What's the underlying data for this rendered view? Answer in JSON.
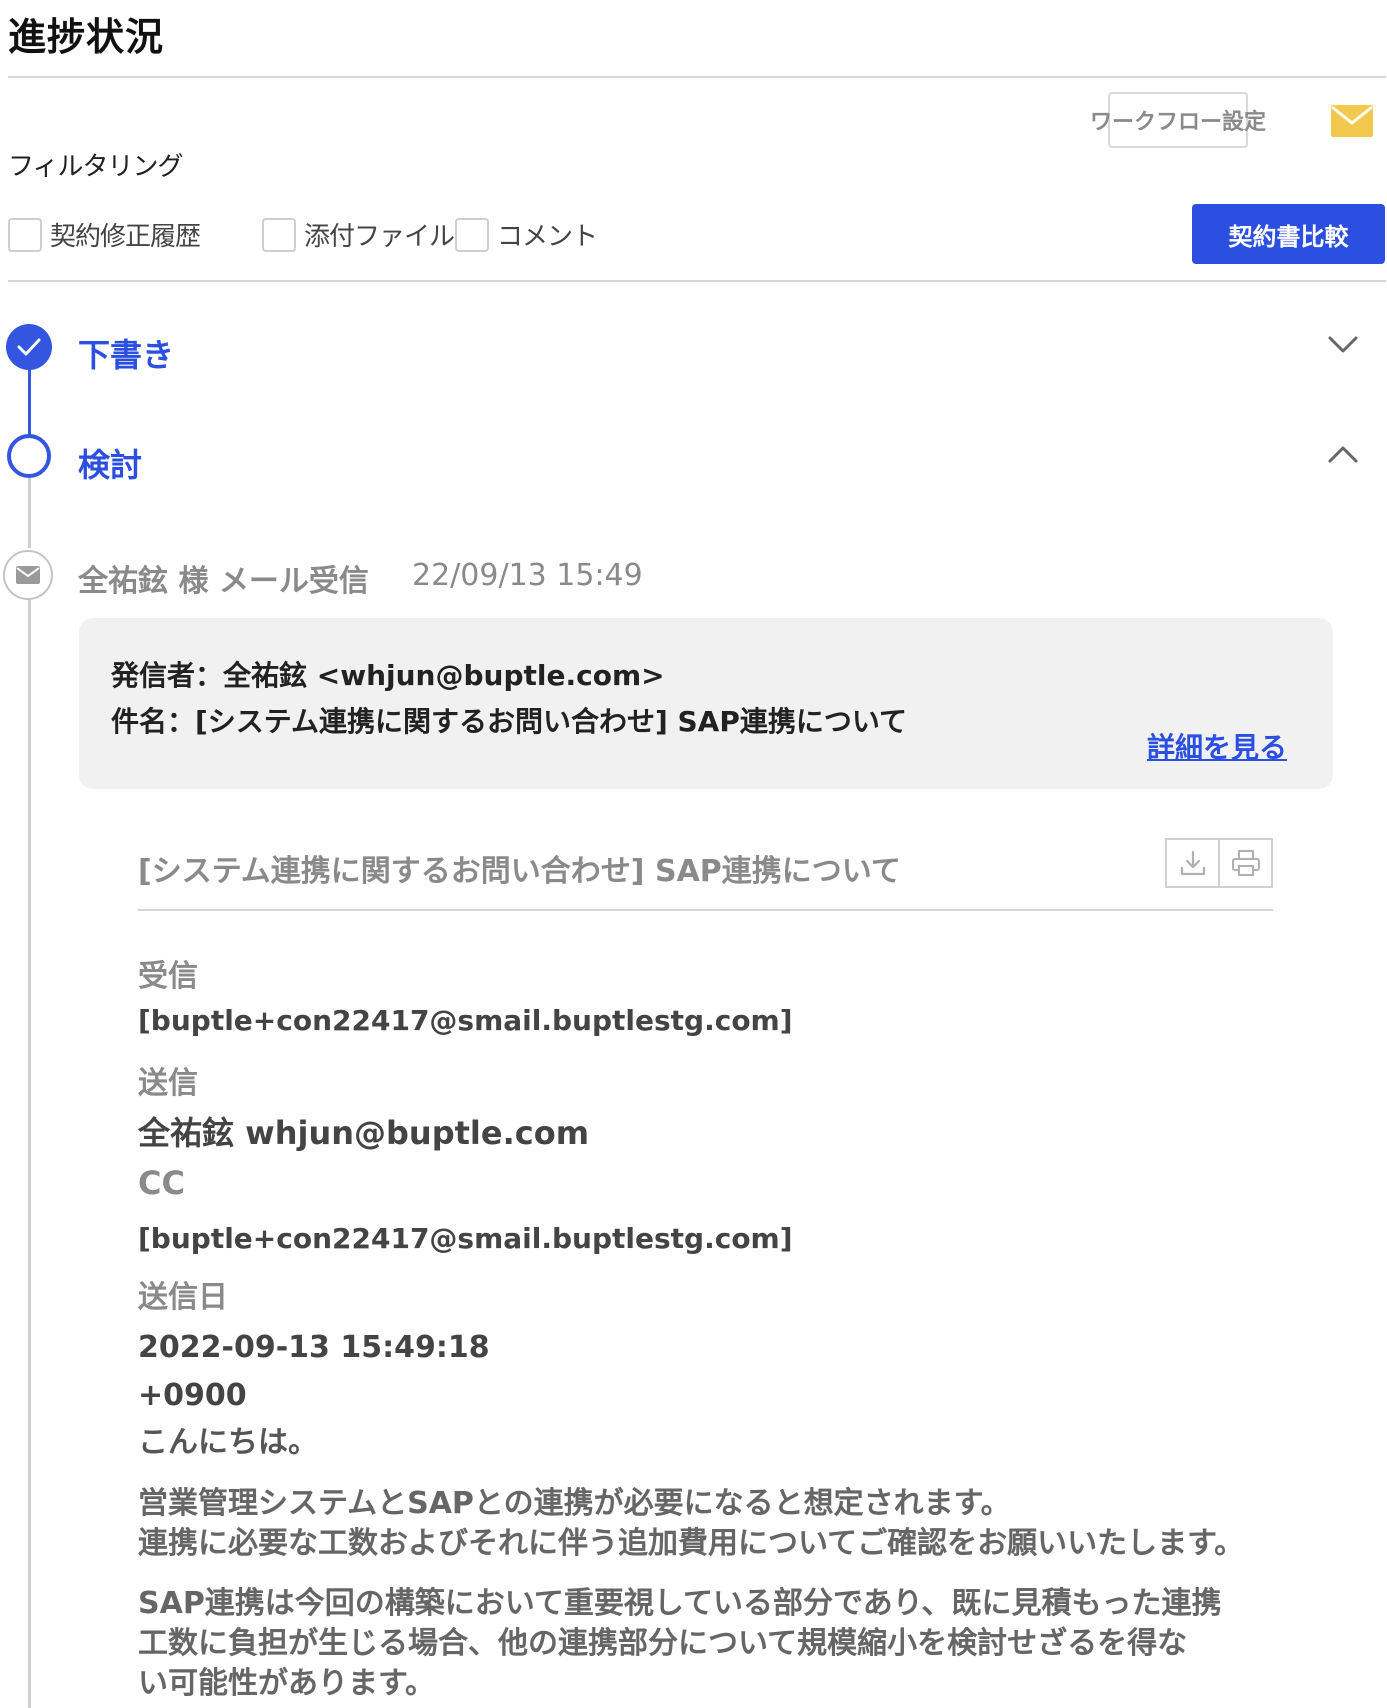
{
  "page": {
    "title": "進捗状況"
  },
  "toolbar": {
    "workflow_label": "ワークフロー設定",
    "compare_label": "契約書比較"
  },
  "filter": {
    "title": "フィルタリング",
    "options": [
      {
        "label": "契約修正履歴",
        "checked": false
      },
      {
        "label": "添付ファイル",
        "checked": false
      },
      {
        "label": "コメント",
        "checked": false
      }
    ]
  },
  "timeline": {
    "steps": [
      {
        "label": "下書き",
        "status": "done",
        "expanded": false
      },
      {
        "label": "検討",
        "status": "current",
        "expanded": true
      }
    ],
    "event": {
      "title": "全祐鉉 様 メール受信",
      "time": "22/09/13 15:49"
    }
  },
  "mail_card": {
    "sender": "発信者：全祐鉉 <whjun@buptle.com>",
    "subject": "件名：[システム連携に関するお問い合わせ] SAP連携について",
    "detail_link": "詳細を見る"
  },
  "email": {
    "subject": "[システム連携に関するお問い合わせ] SAP連携について",
    "to_label": "受信",
    "to_value": "[buptle+con22417@smail.buptlestg.com]",
    "from_label": "送信",
    "from_value": "全祐鉉 whjun@buptle.com",
    "cc_label": "CC",
    "cc_value": "[buptle+con22417@smail.buptlestg.com]",
    "date_label": "送信日",
    "date_value_line1": "2022-09-13 15:49:18",
    "date_value_line2": "+0900",
    "body": {
      "greeting": "こんにちは。",
      "para1_line1": "営業管理システムとSAPとの連携が必要になると想定されます。",
      "para1_line2": "連携に必要な工数およびそれに伴う追加費用についてご確認をお願いいたします。",
      "para2_line1": "SAP連携は今回の構築において重要視している部分であり、既に見積もった連携",
      "para2_line2": "工数に負担が生じる場合、他の連携部分について規模縮小を検討せざるを得な",
      "para2_line3": "い可能性があります。"
    }
  },
  "colors": {
    "accent": "#2b4fe0",
    "mail_icon": "#f2c94c",
    "muted": "#8a8a8a"
  }
}
